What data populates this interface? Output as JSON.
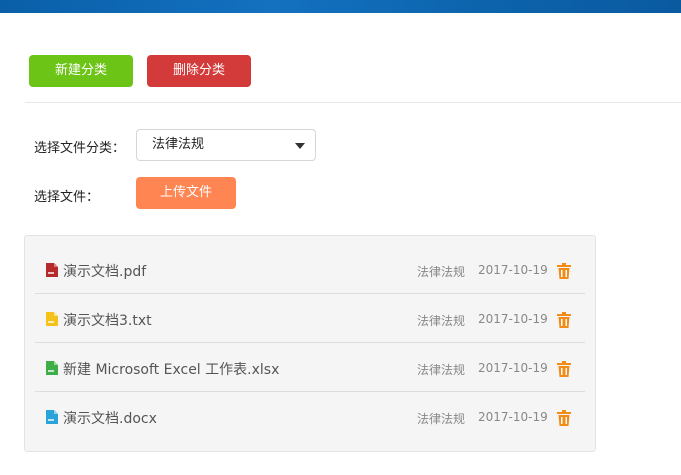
{
  "toolbar": {
    "new_category_label": "新建分类",
    "delete_category_label": "删除分类"
  },
  "form": {
    "category_label": "选择文件分类：",
    "category_selected": "法律法规",
    "file_label": "选择文件：",
    "upload_label": "上传文件"
  },
  "colors": {
    "topbar": "#0d64ad",
    "new_button": "#6cc417",
    "delete_button": "#d33a3a",
    "upload_button": "#ff8552",
    "trash_icon": "#f08c17"
  },
  "files": [
    {
      "name": "演示文档.pdf",
      "category": "法律法规",
      "date": "2017-10-19",
      "icon": "pdf-file-icon",
      "color": "#b52b2b"
    },
    {
      "name": "演示文档3.txt",
      "category": "法律法规",
      "date": "2017-10-19",
      "icon": "txt-file-icon",
      "color": "#f5c21b"
    },
    {
      "name": "新建 Microsoft Excel 工作表.xlsx",
      "category": "法律法规",
      "date": "2017-10-19",
      "icon": "excel-file-icon",
      "color": "#3fae49"
    },
    {
      "name": "演示文档.docx",
      "category": "法律法规",
      "date": "2017-10-19",
      "icon": "word-file-icon",
      "color": "#2aa3d8"
    }
  ]
}
